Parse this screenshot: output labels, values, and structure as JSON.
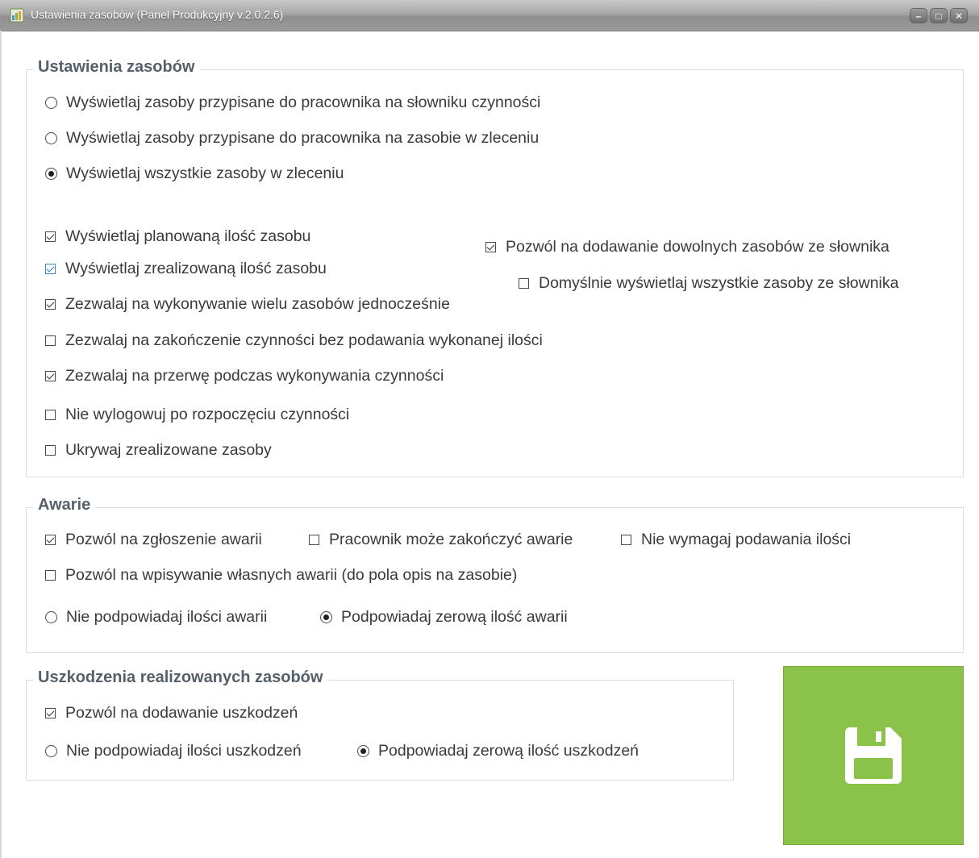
{
  "window": {
    "title": "Ustawienia zasobów (Panel Produkcyjny v.2.0.2.6)",
    "controls": {
      "minimize": "–",
      "maximize": "□",
      "close": "✕"
    }
  },
  "resources": {
    "legend": "Ustawienia zasobów",
    "radios": [
      {
        "label": "Wyświetlaj zasoby przypisane do pracownika na słowniku czynności",
        "selected": false
      },
      {
        "label": "Wyświetlaj zasoby przypisane do pracownika na zasobie w zleceniu",
        "selected": false
      },
      {
        "label": "Wyświetlaj wszystkie zasoby w zleceniu",
        "selected": true
      }
    ],
    "checks": [
      {
        "label": "Wyświetlaj planowaną ilość zasobu",
        "checked": true
      },
      {
        "label": "Wyświetlaj zrealizowaną ilość zasobu",
        "checked": true
      },
      {
        "label": "Zezwalaj na wykonywanie wielu zasobów jednocześnie",
        "checked": true
      },
      {
        "label": "Zezwalaj na zakończenie czynności bez podawania wykonanej ilości",
        "checked": false
      },
      {
        "label": "Zezwalaj na przerwę podczas wykonywania czynności",
        "checked": true
      },
      {
        "label": "Nie wylogowuj po rozpoczęciu czynności",
        "checked": false
      },
      {
        "label": "Ukrywaj zrealizowane zasoby",
        "checked": false
      }
    ],
    "right_checks": [
      {
        "label": "Pozwól na dodawanie dowolnych zasobów ze słownika",
        "checked": true
      },
      {
        "label": "Domyślnie wyświetlaj wszystkie zasoby ze słownika",
        "checked": false
      }
    ]
  },
  "failures": {
    "legend": "Awarie",
    "checks": [
      {
        "label": "Pozwól na zgłoszenie awarii",
        "checked": true
      },
      {
        "label": "Pracownik może zakończyć awarie",
        "checked": false
      },
      {
        "label": "Nie wymagaj podawania ilości",
        "checked": false
      },
      {
        "label": "Pozwól na wpisywanie własnych awarii (do pola opis na zasobie)",
        "checked": false
      }
    ],
    "radios": [
      {
        "label": "Nie podpowiadaj ilości awarii",
        "selected": false
      },
      {
        "label": "Podpowiadaj zerową ilość awarii",
        "selected": true
      }
    ]
  },
  "damages": {
    "legend": "Uszkodzenia realizowanych zasobów",
    "checks": [
      {
        "label": "Pozwól na dodawanie uszkodzeń",
        "checked": true
      }
    ],
    "radios": [
      {
        "label": "Nie podpowiadaj ilości uszkodzeń",
        "selected": false
      },
      {
        "label": "Podpowiadaj zerową ilość uszkodzeń",
        "selected": true
      }
    ]
  },
  "save_button": {
    "icon": "floppy-disk-icon",
    "color": "#8bc34a"
  }
}
